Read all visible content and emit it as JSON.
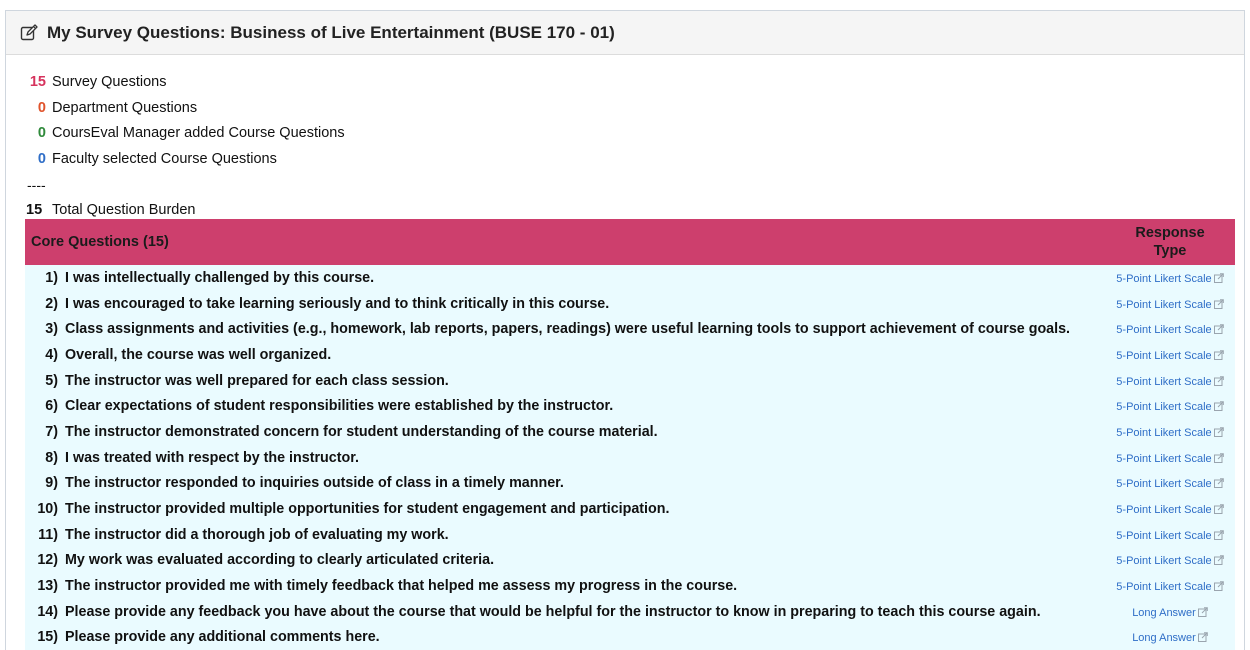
{
  "header": {
    "title": "My Survey Questions: Business of Live Entertainment (BUSE 170 - 01)",
    "icon": "edit-icon"
  },
  "summary": {
    "rows": [
      {
        "count": "15",
        "label": "Survey Questions",
        "color": "#d6335d"
      },
      {
        "count": "0",
        "label": "Department Questions",
        "color": "#e0532b"
      },
      {
        "count": "0",
        "label": "CoursEval Manager added Course Questions",
        "color": "#2f8a3b"
      },
      {
        "count": "0",
        "label": "Faculty selected Course Questions",
        "color": "#2f6ec7"
      }
    ],
    "separator": "----",
    "total": {
      "count": "15",
      "label": "Total Question Burden"
    }
  },
  "table": {
    "header_color": "#cd3f6d",
    "row_color": "#eafbff",
    "section_label": "Core Questions (15)",
    "response_type_header": "Response Type",
    "questions": [
      {
        "num": "1)",
        "text": "I was intellectually challenged by this course.",
        "response": "5-Point Likert Scale"
      },
      {
        "num": "2)",
        "text": "I was encouraged to take learning seriously and to think critically in this course.",
        "response": "5-Point Likert Scale"
      },
      {
        "num": "3)",
        "text": "Class assignments and activities (e.g., homework, lab reports, papers, readings) were useful learning tools to support achievement of course goals.",
        "response": "5-Point Likert Scale"
      },
      {
        "num": "4)",
        "text": "Overall, the course was well organized.",
        "response": "5-Point Likert Scale"
      },
      {
        "num": "5)",
        "text": "The instructor was well prepared for each class session.",
        "response": "5-Point Likert Scale"
      },
      {
        "num": "6)",
        "text": "Clear expectations of student responsibilities were established by the instructor.",
        "response": "5-Point Likert Scale"
      },
      {
        "num": "7)",
        "text": "The instructor demonstrated concern for student understanding of the course material.",
        "response": "5-Point Likert Scale"
      },
      {
        "num": "8)",
        "text": "I was treated with respect by the instructor.",
        "response": "5-Point Likert Scale"
      },
      {
        "num": "9)",
        "text": "The instructor responded to inquiries outside of class in a timely manner.",
        "response": "5-Point Likert Scale"
      },
      {
        "num": "10)",
        "text": "The instructor provided multiple opportunities for student engagement and participation.",
        "response": "5-Point Likert Scale"
      },
      {
        "num": "11)",
        "text": "The instructor did a thorough job of evaluating my work.",
        "response": "5-Point Likert Scale"
      },
      {
        "num": "12)",
        "text": "My work was evaluated according to clearly articulated criteria.",
        "response": "5-Point Likert Scale"
      },
      {
        "num": "13)",
        "text": "The instructor provided me with timely feedback that helped me assess my progress in the course.",
        "response": "5-Point Likert Scale"
      },
      {
        "num": "14)",
        "text": "Please provide any feedback you have about the course that would be helpful for the instructor to know in preparing to teach this course again.",
        "response": "Long Answer"
      },
      {
        "num": "15)",
        "text": "Please provide any additional comments here.",
        "response": "Long Answer"
      }
    ]
  }
}
